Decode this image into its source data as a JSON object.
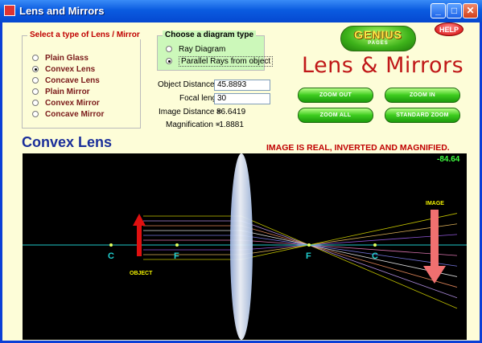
{
  "window": {
    "title": "Lens and Mirrors",
    "minimize_glyph": "_",
    "maximize_glyph": "□",
    "close_glyph": "✕"
  },
  "lens_group": {
    "title": "Select a type of Lens / Mirror",
    "options": [
      {
        "label": "Plain Glass",
        "selected": false
      },
      {
        "label": "Convex Lens",
        "selected": true
      },
      {
        "label": "Concave Lens",
        "selected": false
      },
      {
        "label": "Plain Mirror",
        "selected": false
      },
      {
        "label": "Convex Mirror",
        "selected": false
      },
      {
        "label": "Concave Mirror",
        "selected": false
      }
    ]
  },
  "diagram_group": {
    "title": "Choose a diagram type",
    "options": [
      {
        "label": "Ray Diagram",
        "selected": false
      },
      {
        "label": "Parallel Rays from object",
        "selected": true
      }
    ]
  },
  "fields": {
    "object_distance_label": "Object Distance =",
    "object_distance_value": "45.8893",
    "focal_length_label": "Focal length =",
    "focal_length_value": "30",
    "image_distance_label": "Image Distance =",
    "image_distance_value": "86.6419",
    "magnification_label": "Magnification =",
    "magnification_value": "-1.8881"
  },
  "branding": {
    "logo_main": "GENIUS",
    "logo_sub": "PAGES",
    "help_label": "HELP",
    "app_title": "Lens & Mirrors"
  },
  "zoom_buttons": {
    "zoom_out": "ZOOM OUT",
    "zoom_in": "ZOOM IN",
    "zoom_all": "ZOOM ALL",
    "standard_zoom": "STANDARD ZOOM"
  },
  "diagram": {
    "lens_type_label": "Convex Lens",
    "status_text": "IMAGE IS REAL, INVERTED AND MAGNIFIED.",
    "coordinate_readout": "-84.64",
    "object_label": "OBJECT",
    "image_label": "IMAGE",
    "focal_point_labels": [
      "C",
      "F",
      "F",
      "C"
    ],
    "colors": {
      "axis": "#1ec8c8",
      "object_arrow": "#e01010",
      "image_arrow": "#f07070",
      "point_labels": "#20d0d0",
      "marker_labels": "#f0f000",
      "readout": "#40ff40"
    }
  }
}
